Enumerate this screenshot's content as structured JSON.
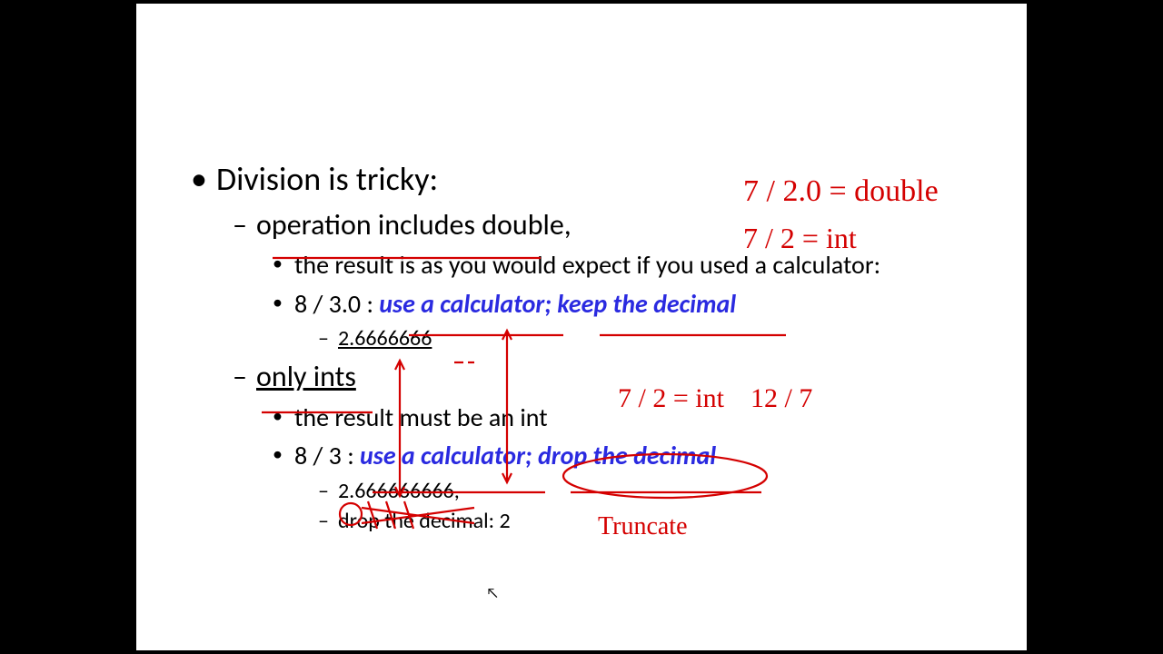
{
  "slide": {
    "title": "Division is tricky:",
    "sub1": {
      "heading": "operation includes double,",
      "point1": "the result is as you would expect if you used a calculator:",
      "point2_prefix": "8 / 3.0 :   ",
      "point2_blue": "use a calculator; keep the decimal",
      "result": "2.6666666"
    },
    "sub2": {
      "heading": "only ints",
      "point1": "the result must be an int",
      "point2_prefix": "8 / 3 : ",
      "point2_blue1": "use a calculator;  ",
      "point2_blue2": "drop the decimal",
      "result1": "2.666666666,",
      "result2": "drop the decimal: 2"
    }
  },
  "annotations": {
    "top_right_1": "7 / 2.0 = double",
    "top_right_2": "7 / 2 = int",
    "mid_right_1": "7 / 2 = int",
    "mid_right_2": "12 / 7",
    "truncate": "Truncate"
  }
}
